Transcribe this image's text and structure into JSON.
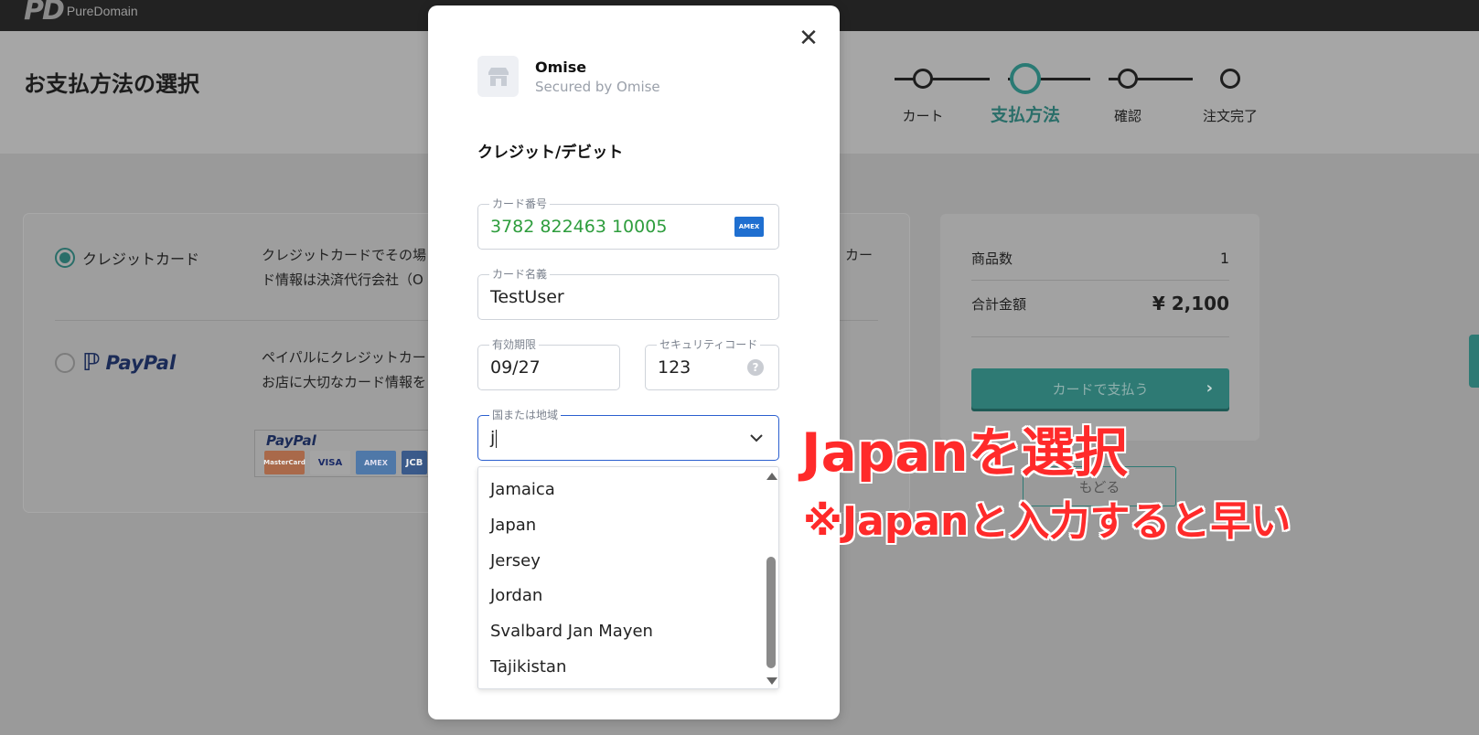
{
  "brand": {
    "mark": "PD",
    "name": "PureDomain"
  },
  "page_title": "お支払方法の選択",
  "steps": [
    {
      "label": "カート",
      "active": false
    },
    {
      "label": "支払方法",
      "active": true
    },
    {
      "label": "確認",
      "active": false
    },
    {
      "label": "注文完了",
      "active": false
    }
  ],
  "payment_methods": {
    "credit": {
      "label": "クレジットカード",
      "desc_line1": "クレジットカードでその場",
      "desc_line1_tail": "カー",
      "desc_line2": "ド情報は決済代行会社（O"
    },
    "paypal": {
      "label": "PayPal",
      "desc_line1": "ペイパルにクレジットカー",
      "desc_line2": "お店に大切なカード情報を",
      "box_logo": "PayPal",
      "cards": [
        "MasterCard",
        "VISA",
        "AMEX",
        "JCB"
      ]
    }
  },
  "summary": {
    "items_label": "商品数",
    "items_value": "1",
    "total_label": "合計金額",
    "total_value": "¥ 2,100",
    "pay_button": "カードで支払う",
    "back_button": "もどる"
  },
  "modal": {
    "merchant_name": "Omise",
    "merchant_sub": "Secured by Omise",
    "section_title": "クレジット/デビット",
    "card_number": {
      "label": "カード番号",
      "value": "3782 822463 10005",
      "brand": "AMEX"
    },
    "card_name": {
      "label": "カード名義",
      "value": "TestUser"
    },
    "expiry": {
      "label": "有効期限",
      "value": "09/27"
    },
    "cvc": {
      "label": "セキュリティコード",
      "value": "123"
    },
    "country": {
      "label": "国または地域",
      "value": "j"
    },
    "dropdown_options": [
      "Jamaica",
      "Japan",
      "Jersey",
      "Jordan",
      "Svalbard Jan Mayen",
      "Tajikistan"
    ]
  },
  "annotations": {
    "line1": "Japanを選択",
    "line2": "※Japanと入力すると早い"
  },
  "colors": {
    "accent": "#2e7a74",
    "annotation": "#ff2a2a",
    "card_number_text": "#2e9d3d",
    "focus": "#2b5fcf"
  }
}
